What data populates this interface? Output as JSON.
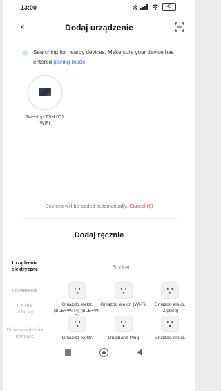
{
  "status": {
    "time": "13:00",
    "battery": "45"
  },
  "header": {
    "title": "Dodaj urządzenie",
    "back_icon": "chevron-left-icon",
    "scan_icon": "scan-frame-icon"
  },
  "search": {
    "text": "Searching for nearby devices. Make sure your device has entered ",
    "link": "pairing mode"
  },
  "found_device": {
    "name": "Tweetop TSH 001 WIFI"
  },
  "auto_info": {
    "text": "Devices will be added automatically.",
    "cancel": "Cancel (6)"
  },
  "manual": {
    "title": "Dodaj ręcznie",
    "subhead": "Socket",
    "categories": [
      {
        "label": "Urządzenia elektryczne",
        "active": true
      },
      {
        "label": "Oświetlenie",
        "active": false
      },
      {
        "label": "Czujnik ochrony",
        "active": false
      },
      {
        "label": "Duże urządzenia domowe",
        "active": false
      }
    ],
    "tiles": [
      {
        "label": "Gniazdo elektr. (BLE+Wi-Fi) (BLE+Wi-Fi)"
      },
      {
        "label": "Gniazdo elektr. (Wi-Fi)"
      },
      {
        "label": "Gniazdo elektr. (Zigbee)"
      },
      {
        "label": "Gniazdo elektr."
      },
      {
        "label": "Dualband Plug"
      },
      {
        "label": "Gniazdo elektr."
      }
    ]
  },
  "colors": {
    "accent": "#1a7de6",
    "cancel": "#e04848"
  }
}
